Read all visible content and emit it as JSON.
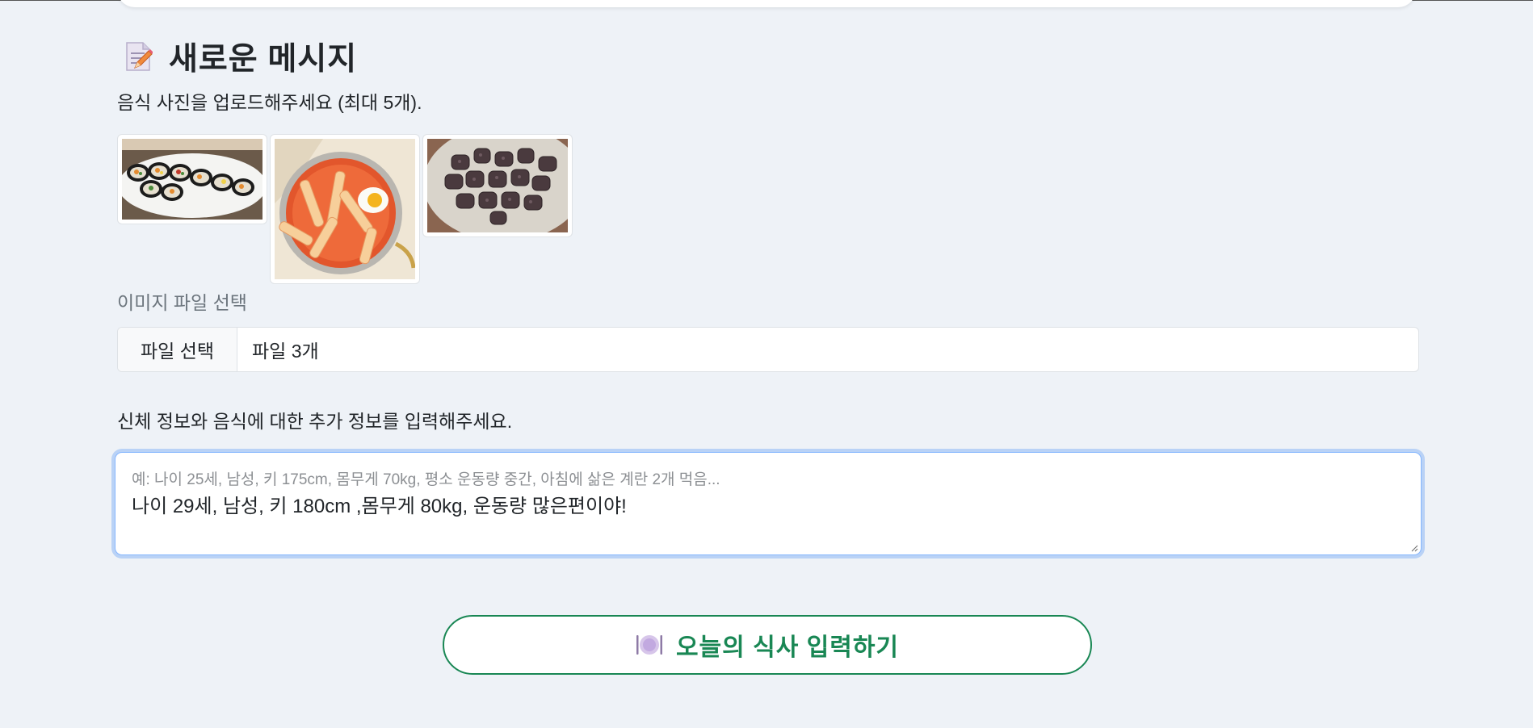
{
  "form": {
    "heading": "새로운 메시지",
    "heading_icon": "memo-icon",
    "upload_instruction": "음식 사진을 업로드해주세요 (최대 5개).",
    "thumbnails": [
      {
        "name": "kimbap-photo"
      },
      {
        "name": "tteokbokki-photo"
      },
      {
        "name": "sundae-photo"
      }
    ],
    "file_label": "이미지 파일 선택",
    "file_button_label": "파일 선택",
    "file_status": "파일 3개",
    "info_label": "신체 정보와 음식에 대한 추가 정보를 입력해주세요.",
    "info_placeholder": "예: 나이 25세, 남성, 키 175cm, 몸무게 70kg, 평소 운동량 중간, 아침에 삶은 계란 2개 먹음...",
    "info_value": "나이 29세, 남성, 키 180cm ,몸무게 80kg, 운동량 많은편이야!",
    "submit_label": "오늘의 식사 입력하기",
    "submit_icon": "plate-icon"
  },
  "colors": {
    "background": "#eef2f7",
    "accent_green": "#198754",
    "focus_ring": "#b9d2f6"
  }
}
